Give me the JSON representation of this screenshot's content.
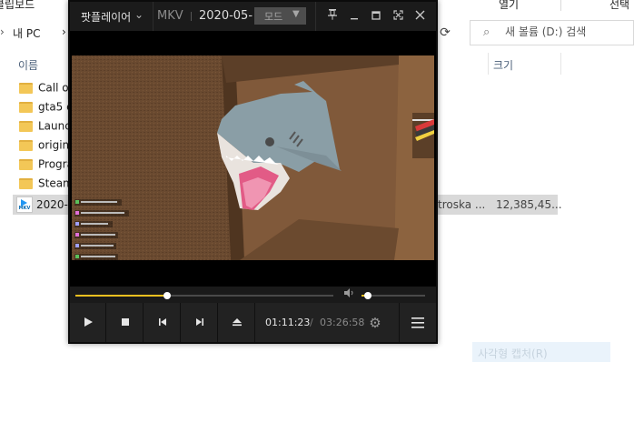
{
  "explorer": {
    "ribbon": {
      "left_label": "클립보드",
      "open_label": "열기",
      "select_label": "선택"
    },
    "address": {
      "chevron": "›",
      "path_part1": "내 PC",
      "path_part2": "›",
      "refresh_icon": "refresh-icon"
    },
    "search": {
      "placeholder": "새 볼륨 (D:) 검색"
    },
    "columns": {
      "name": "이름",
      "size": "크기"
    },
    "files": [
      {
        "name": "Call of"
      },
      {
        "name": "gta5 e"
      },
      {
        "name": "Launch"
      },
      {
        "name": "origin"
      },
      {
        "name": "Progra"
      },
      {
        "name": "Steam"
      }
    ],
    "selected_file": {
      "name": "2020-",
      "type": "troska ...",
      "size": "12,385,45..."
    },
    "ghost_menu": "사각형 캡처(R)"
  },
  "player": {
    "app_name": "팟플레이어",
    "format": "MKV",
    "file_title": "2020-05-",
    "mode_label": "모드",
    "titlebar_icons": [
      "pin-icon",
      "minimize-icon",
      "maximize-icon",
      "fullscreen-icon",
      "close-icon"
    ],
    "seek_progress": 0.356,
    "volume_level": 0.1,
    "time_current": "01:11:23",
    "time_separator": "/",
    "time_total": "03:26:58",
    "controls": [
      "play-icon",
      "stop-icon",
      "previous-icon",
      "next-icon",
      "eject-icon",
      "gear-icon",
      "menu-icon"
    ],
    "colors": {
      "accent": "#f0c020",
      "titlebar": "#1b1b1b",
      "controlbar": "#222222"
    }
  }
}
